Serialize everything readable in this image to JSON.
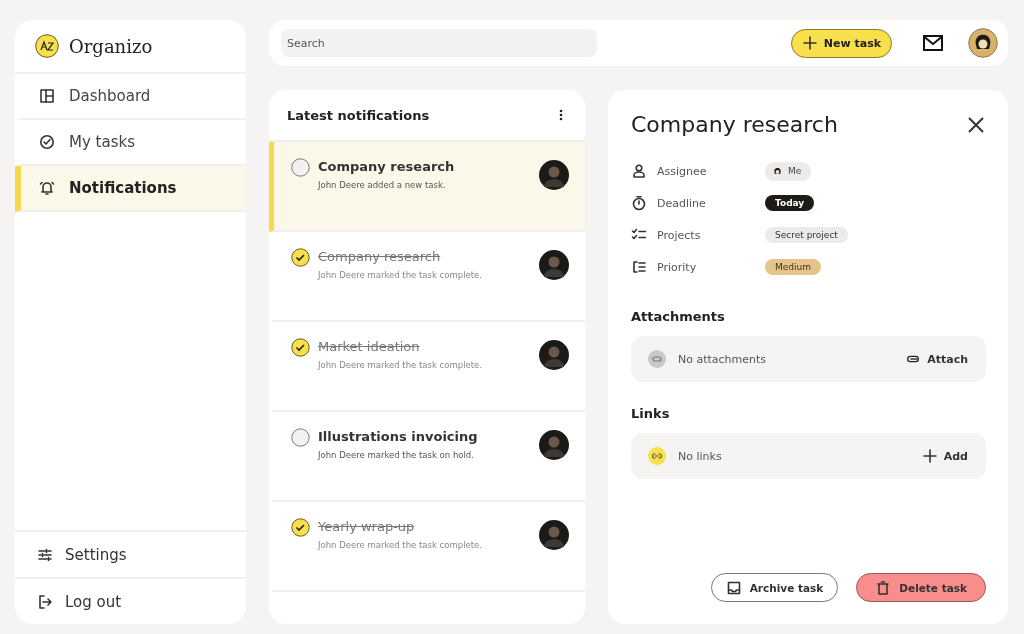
{
  "sidebar": {
    "app_name": "Organizo",
    "nav_items": [
      {
        "label": "Dashboard",
        "selected": false
      },
      {
        "label": "My tasks",
        "selected": false
      },
      {
        "label": "Notifications",
        "selected": true
      }
    ],
    "footer_items": [
      {
        "label": "Settings"
      },
      {
        "label": "Log out"
      }
    ]
  },
  "topbar": {
    "search": {
      "placeholder": "Search"
    },
    "new_task_button": "New task"
  },
  "notifications": {
    "title": "Latest notifications",
    "items": [
      {
        "title": "Company research",
        "message": "John Deere added a new task.",
        "checked": false,
        "selected": true
      },
      {
        "title": "Company research",
        "message": "John Deere marked the task complete.",
        "checked": true,
        "selected": false
      },
      {
        "title": "Market ideation",
        "message": "John Deere marked the task complete.",
        "checked": true,
        "selected": false
      },
      {
        "title": "Illustrations invoicing",
        "message": "John Deere marked the task on hold.",
        "checked": false,
        "selected": false
      },
      {
        "title": "Yearly wrap-up",
        "message": "John Deere marked the task complete.",
        "checked": true,
        "selected": false
      }
    ]
  },
  "detail": {
    "title": "Company research",
    "properties": [
      {
        "label": "Assignee",
        "value": "Me",
        "kind": "person"
      },
      {
        "label": "Deadline",
        "value": "Today",
        "kind": "dark"
      },
      {
        "label": "Projects",
        "value": "Secret project",
        "kind": "plain"
      },
      {
        "label": "Priority",
        "value": "Medium",
        "kind": "tan"
      }
    ],
    "attachments": {
      "heading": "Attachments",
      "empty_text": "No attachments",
      "action": "Attach"
    },
    "links": {
      "heading": "Links",
      "empty_text": "No links",
      "action": "Add"
    },
    "buttons": [
      {
        "label": "Archive task",
        "kind": "archive"
      },
      {
        "label": "Delete task",
        "kind": "delete"
      }
    ]
  }
}
